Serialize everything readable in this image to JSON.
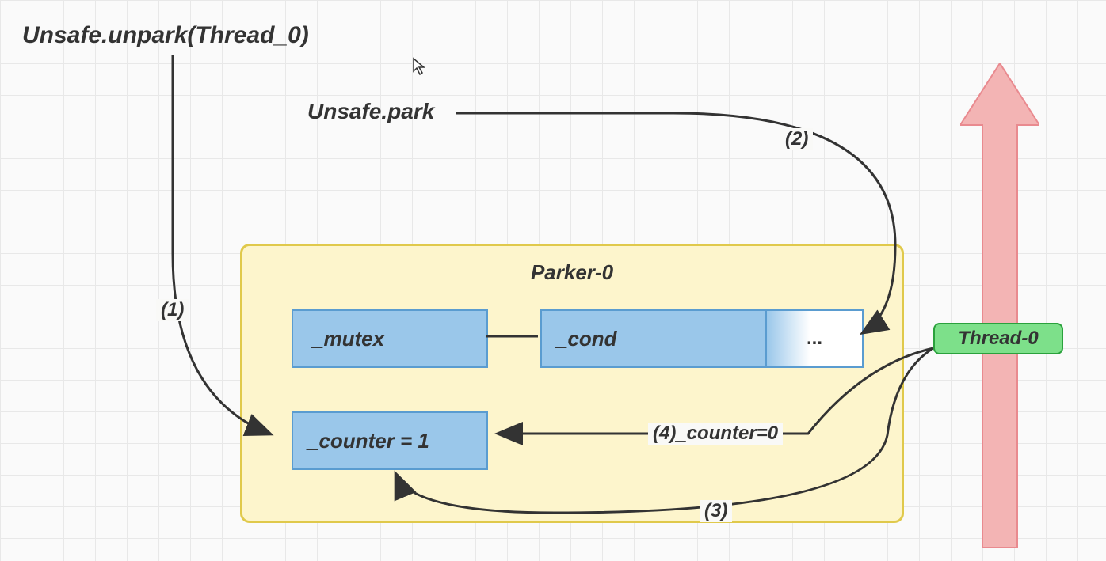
{
  "labels": {
    "unpark": "Unsafe.unpark(Thread_0)",
    "park": "Unsafe.park",
    "parker_title": "Parker-0",
    "mutex": "_mutex",
    "cond": "_cond",
    "queue": "...",
    "counter": "_counter = 1",
    "thread": "Thread-0",
    "step1": "(1)",
    "step2": "(2)",
    "step3": "(3)",
    "step4": "(4)_counter=0"
  }
}
